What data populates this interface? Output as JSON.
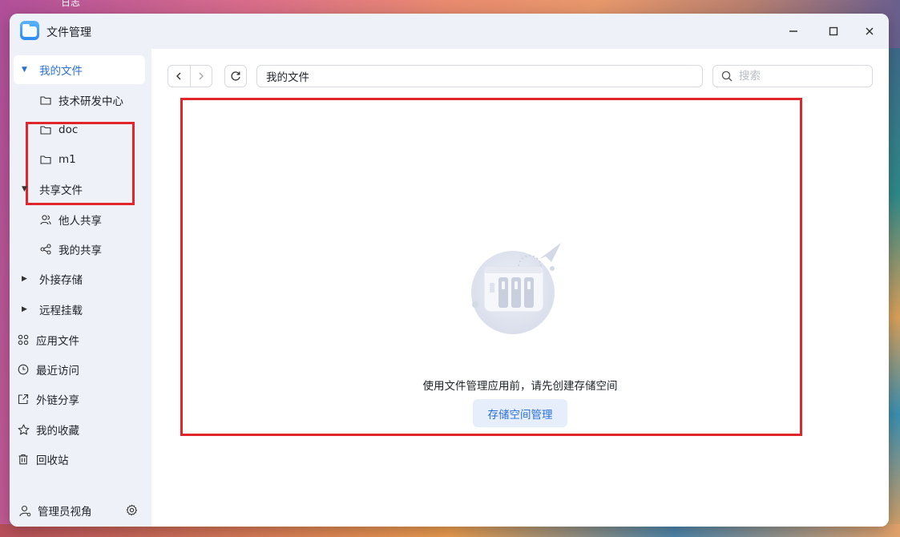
{
  "desktop": {
    "top_label": "日志"
  },
  "window": {
    "title": "文件管理",
    "controls": {
      "minimize": "—",
      "maximize": "☐",
      "close": "✕"
    }
  },
  "sidebar": {
    "my_files": "我的文件",
    "my_files_children": [
      "技术研发中心",
      "doc",
      "m1"
    ],
    "shared_files": "共享文件",
    "shared_children": [
      "他人共享",
      "我的共享"
    ],
    "external_storage": "外接存储",
    "remote_mount": "远程挂载",
    "app_files": "应用文件",
    "recent": "最近访问",
    "external_links": "外链分享",
    "favorites": "我的收藏",
    "recycle_bin": "回收站",
    "admin_view": "管理员视角"
  },
  "toolbar": {
    "path": "我的文件",
    "search_placeholder": "搜索"
  },
  "empty_state": {
    "message": "使用文件管理应用前，请先创建存储空间",
    "button": "存储空间管理"
  },
  "colors": {
    "accent": "#2a6fd6",
    "highlight_box": "#e0262b",
    "sidebar_bg": "#eef1f8"
  }
}
